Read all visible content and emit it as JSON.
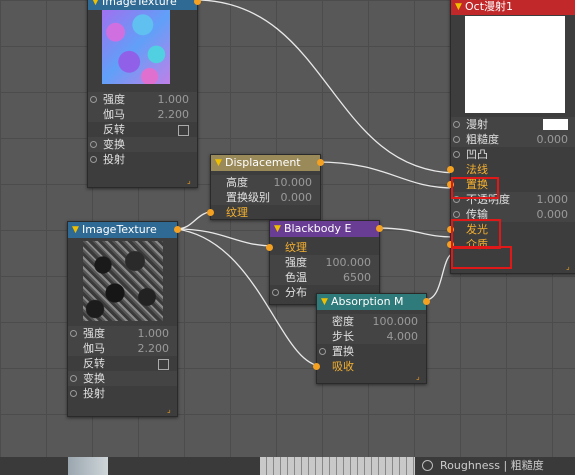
{
  "nodes": {
    "image_texture_top": {
      "title": "ImageTexture",
      "params": [
        {
          "label": "强度",
          "value": "1.000"
        },
        {
          "label": "伽马",
          "value": "2.200"
        },
        {
          "label": "反转",
          "value": ""
        },
        {
          "label": "变换",
          "value": ""
        },
        {
          "label": "投射",
          "value": ""
        }
      ]
    },
    "displacement": {
      "title": "Displacement",
      "params": [
        {
          "label": "高度",
          "value": "10.000"
        },
        {
          "label": "置换级别",
          "value": "0.000"
        },
        {
          "label": "纹理",
          "value": ""
        }
      ]
    },
    "image_texture_bottom": {
      "title": "ImageTexture",
      "params": [
        {
          "label": "强度",
          "value": "1.000"
        },
        {
          "label": "伽马",
          "value": "2.200"
        },
        {
          "label": "反转",
          "value": ""
        },
        {
          "label": "变换",
          "value": ""
        },
        {
          "label": "投射",
          "value": ""
        }
      ]
    },
    "blackbody": {
      "title": "Blackbody E",
      "params": [
        {
          "label": "纹理",
          "value": ""
        },
        {
          "label": "强度",
          "value": "100.000"
        },
        {
          "label": "色温",
          "value": "6500"
        },
        {
          "label": "分布",
          "value": ""
        }
      ]
    },
    "absorption": {
      "title": "Absorption M",
      "params": [
        {
          "label": "密度",
          "value": "100.000"
        },
        {
          "label": "步长",
          "value": "4.000"
        },
        {
          "label": "置换",
          "value": ""
        },
        {
          "label": "吸收",
          "value": ""
        }
      ]
    },
    "oct_material": {
      "title": "Oct漫射1",
      "params": [
        {
          "label": "漫射",
          "value": ""
        },
        {
          "label": "粗糙度",
          "value": "0.000"
        },
        {
          "label": "凹凸",
          "value": ""
        },
        {
          "label": "法线",
          "value": ""
        },
        {
          "label": "置换",
          "value": ""
        },
        {
          "label": "不透明度",
          "value": "1.000"
        },
        {
          "label": "传输",
          "value": "0.000"
        },
        {
          "label": "发光",
          "value": ""
        },
        {
          "label": "介质",
          "value": ""
        }
      ]
    }
  },
  "status_bar": {
    "text": "Roughness | 粗糙度"
  },
  "colors": {
    "node_header_blue": "#2e6a94",
    "node_header_khaki": "#9a8a5a",
    "node_header_purple": "#6a3d94",
    "node_header_teal": "#2f7a7a",
    "node_header_red": "#c0282a",
    "socket_orange": "#f4a020",
    "highlight_red": "#e01818"
  }
}
